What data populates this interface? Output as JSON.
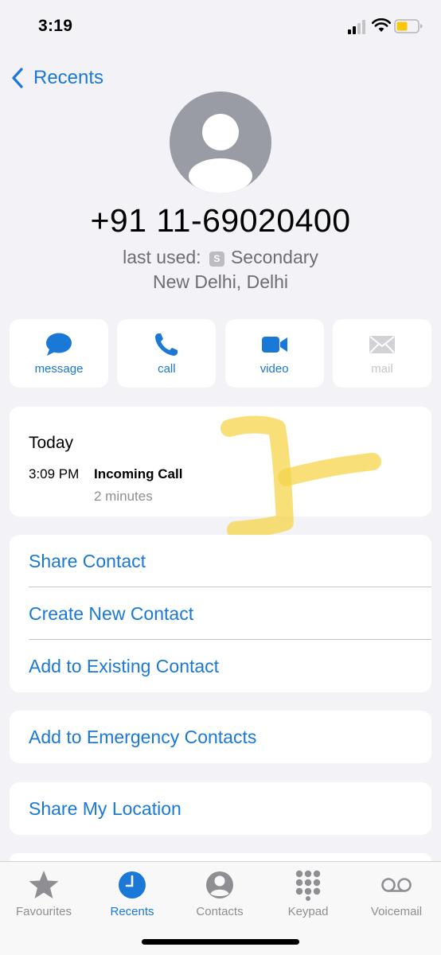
{
  "status_bar": {
    "time": "3:19"
  },
  "nav": {
    "back_label": "Recents"
  },
  "contact": {
    "number": "+91 11-69020400",
    "last_used_label": "last used:",
    "sim_badge": "S",
    "sim_name": "Secondary",
    "location": "New Delhi, Delhi"
  },
  "actions": [
    {
      "label": "message",
      "icon": "message-icon",
      "enabled": true
    },
    {
      "label": "call",
      "icon": "phone-icon",
      "enabled": true
    },
    {
      "label": "video",
      "icon": "video-icon",
      "enabled": true
    },
    {
      "label": "mail",
      "icon": "mail-icon",
      "enabled": false
    }
  ],
  "history": {
    "day": "Today",
    "time": "3:09 PM",
    "type": "Incoming Call",
    "duration": "2 minutes"
  },
  "contact_actions": [
    "Share Contact",
    "Create New Contact",
    "Add to Existing Contact"
  ],
  "emergency_label": "Add to Emergency Contacts",
  "share_location_label": "Share My Location",
  "tabs": [
    {
      "label": "Favourites",
      "icon": "star-icon",
      "active": false
    },
    {
      "label": "Recents",
      "icon": "clock-icon",
      "active": true
    },
    {
      "label": "Contacts",
      "icon": "person-icon",
      "active": false
    },
    {
      "label": "Keypad",
      "icon": "keypad-icon",
      "active": false
    },
    {
      "label": "Voicemail",
      "icon": "voicemail-icon",
      "active": false
    }
  ],
  "colors": {
    "accent": "#1a78d6",
    "background": "#f2f2f7",
    "highlight": "#f5d44a",
    "battery": "#f7c80c"
  }
}
